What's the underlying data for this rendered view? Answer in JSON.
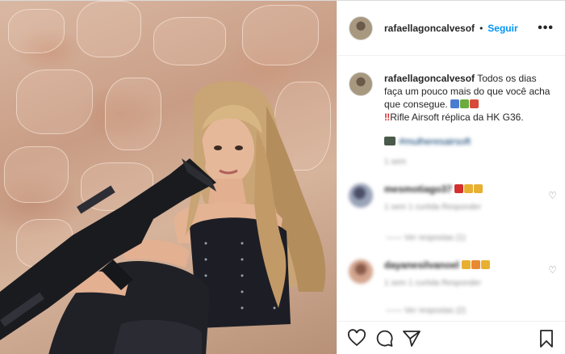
{
  "post": {
    "username": "rafaellagoncalvesof",
    "follow_label": "Seguir",
    "separator": "•",
    "more_label": "•••"
  },
  "caption": {
    "username": "rafaellagoncalvesof",
    "line1": "Todos os dias faça um pouco mais do que você acha que consegue.",
    "line2": "Rifle Airsoft réplica da HK G36.",
    "hashtag_blurred": "#mulheresairsoft",
    "time_blurred": "1 sem"
  },
  "comments": [
    {
      "user_blurred": "mesmotiago37",
      "meta_blurred": "1 sem  1 curtida  Responder",
      "replies_blurred": "Ver respostas (1)",
      "emoji_colors": [
        "#d43030",
        "#e8b032",
        "#e8b032"
      ]
    },
    {
      "user_blurred": "dayanesilvanoel",
      "meta_blurred": "1 sem  1 curtida  Responder",
      "replies_blurred": "Ver respostas (2)",
      "emoji_colors": [
        "#e8b032",
        "#e88a32",
        "#e8b032"
      ]
    }
  ],
  "icons": [
    "more-icon",
    "heart-icon",
    "comment-icon",
    "share-icon",
    "bookmark-icon",
    "warning-icon"
  ],
  "colors": {
    "follow": "#0095f6",
    "muted": "#8e8e8e",
    "text": "#262626"
  }
}
